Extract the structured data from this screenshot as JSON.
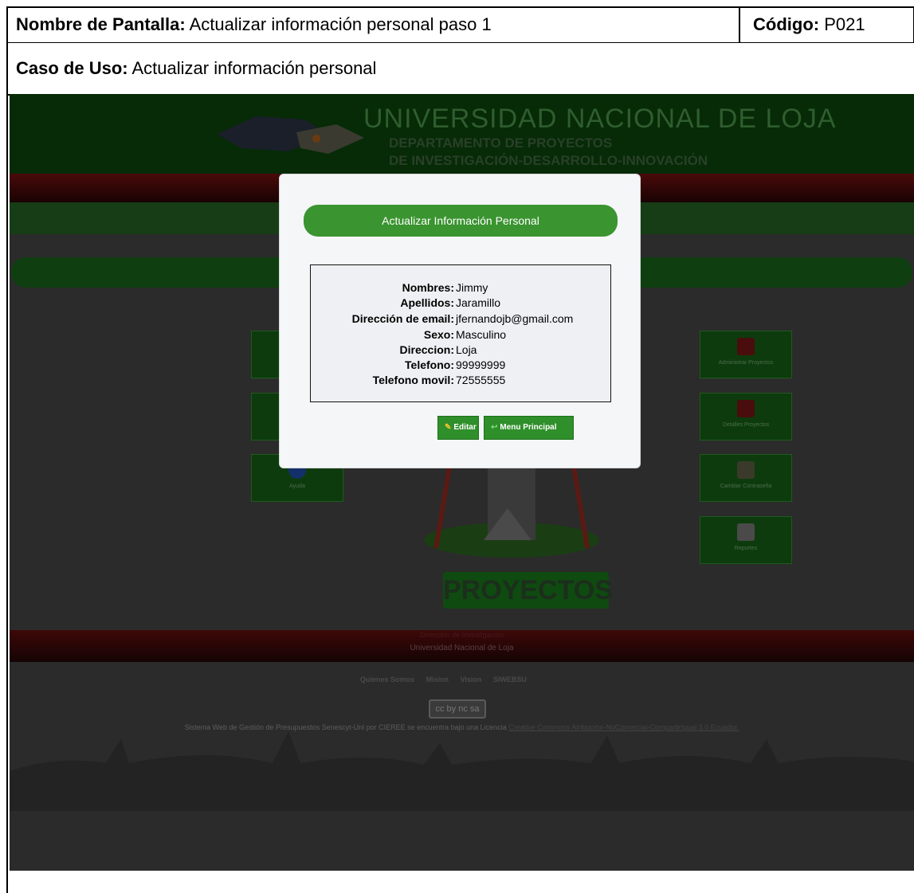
{
  "doc": {
    "screen_name_label": "Nombre de Pantalla:",
    "screen_name": "Actualizar información personal paso 1",
    "code_label": "Código:",
    "code": "P021",
    "use_case_label": "Caso de Uso:",
    "use_case": "Actualizar información personal"
  },
  "site": {
    "title": "UNIVERSIDAD  NACIONAL  DE  LOJA",
    "dept_line1": "DEPARTAMENTO DE PROYECTOS",
    "dept_line2": "DE INVESTIGACIÓN-DESARROLLO-INNOVACIÓN",
    "logo_text": "PROYECTOS",
    "tiles_right": [
      "Administrar Proyectos",
      "Detalles Proyectos",
      "Cambiar Contraseña",
      "Reportes"
    ],
    "tile_left_help": "Ayuda"
  },
  "footer": {
    "line1": "Direccion de Investigacion",
    "line2": "Universidad Nacional de Loja",
    "links": [
      "Quienes Somos",
      "Mision",
      "Vision",
      "SIWEBSU"
    ],
    "license_text": "Sistema Web de Gestión de Presupuestos Senescyt-Unl por CIEREE se encuentra bajo una Licencia",
    "license_link": "Creative Commons Atribución-NoComercial-CompartirIgual 3.0 Ecuador.",
    "cc_badge": "cc by nc sa"
  },
  "modal": {
    "title": "Actualizar Información Personal",
    "fields": [
      {
        "label": "Nombres:",
        "value": "Jimmy"
      },
      {
        "label": "Apellidos:",
        "value": "Jaramillo"
      },
      {
        "label": "Dirección de email:",
        "value": "jfernandojb@gmail.com"
      },
      {
        "label": "Sexo:",
        "value": "Masculino"
      },
      {
        "label": "Direccion:",
        "value": "Loja"
      },
      {
        "label": "Telefono:",
        "value": "99999999"
      },
      {
        "label": "Telefono movil:",
        "value": "72555555"
      }
    ],
    "edit_button": "Editar",
    "menu_button": "Menu Principal"
  }
}
